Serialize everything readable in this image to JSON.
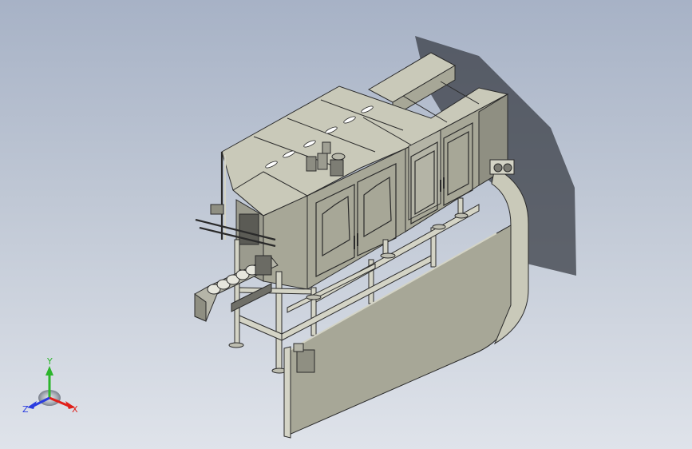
{
  "viewport": {
    "background_top": "#a7b2c6",
    "background_bottom": "#dfe3ea"
  },
  "model": {
    "body_color": "#c9c9b9",
    "body_dark": "#a7a797",
    "body_shadow": "#8f8f82",
    "frame_color": "#d4d4c6",
    "edge_color": "#2a2a2a",
    "shadow_color": "#3a3e45"
  },
  "triad": {
    "x_label": "X",
    "y_label": "Y",
    "z_label": "Z",
    "x_color": "#e0201a",
    "y_color": "#2cb52c",
    "z_color": "#2a3ce0"
  }
}
